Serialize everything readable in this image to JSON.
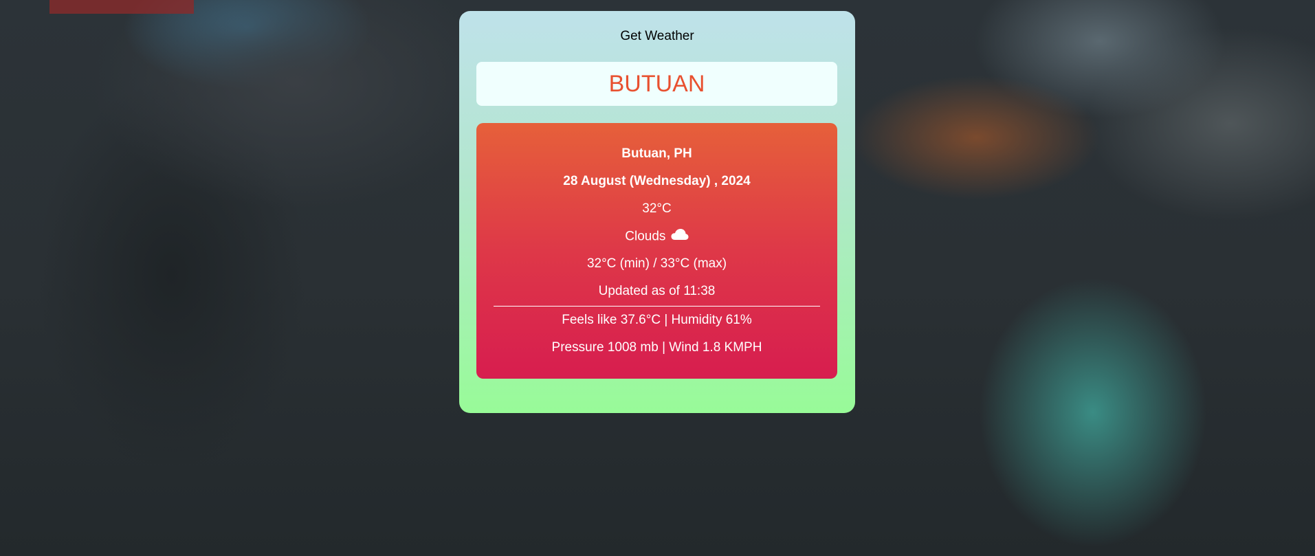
{
  "card": {
    "title": "Get Weather",
    "city_input_value": "BUTUAN"
  },
  "weather": {
    "location": "Butuan, PH",
    "date": "28 August (Wednesday) , 2024",
    "temperature": "32°C",
    "condition": "Clouds",
    "condition_icon": "cloud-icon",
    "min_max": "32°C (min) / 33°C (max)",
    "updated": "Updated as of 11:38",
    "feels_humidity": "Feels like 37.6°C | Humidity 61%",
    "pressure_wind": "Pressure 1008 mb | Wind 1.8 KMPH"
  },
  "colors": {
    "city_text": "#e8502f",
    "card_top": "#bfe2ea",
    "card_bottom": "#98fb98",
    "result_top": "#e6603a",
    "result_bottom": "#d71d4f"
  }
}
